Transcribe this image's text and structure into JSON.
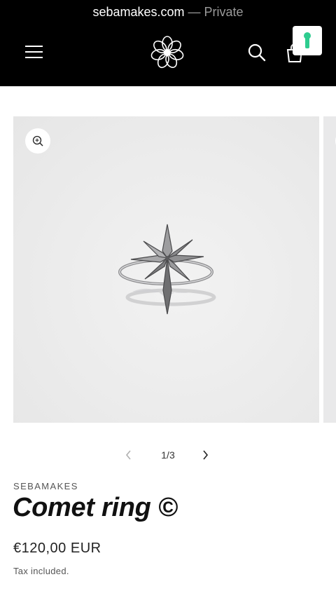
{
  "browser": {
    "domain": "sebamakes.com",
    "separator": " — ",
    "mode": "Private"
  },
  "header": {
    "menu_icon": "hamburger-menu-icon",
    "logo_icon": "flower-logo-icon",
    "search_icon": "search-icon",
    "cart_icon": "shopping-bag-icon",
    "badge_icon": "keyhole-icon",
    "badge_color": "#2ecc8f"
  },
  "gallery": {
    "zoom_icon": "zoom-in-icon",
    "current_page": 1,
    "total_pages": 3,
    "counter": "1/3",
    "prev_icon": "chevron-left-icon",
    "next_icon": "chevron-right-icon"
  },
  "product": {
    "vendor": "SEBAMAKES",
    "title": "Comet ring ©",
    "price": "€120,00 EUR",
    "tax_note": "Tax included."
  }
}
